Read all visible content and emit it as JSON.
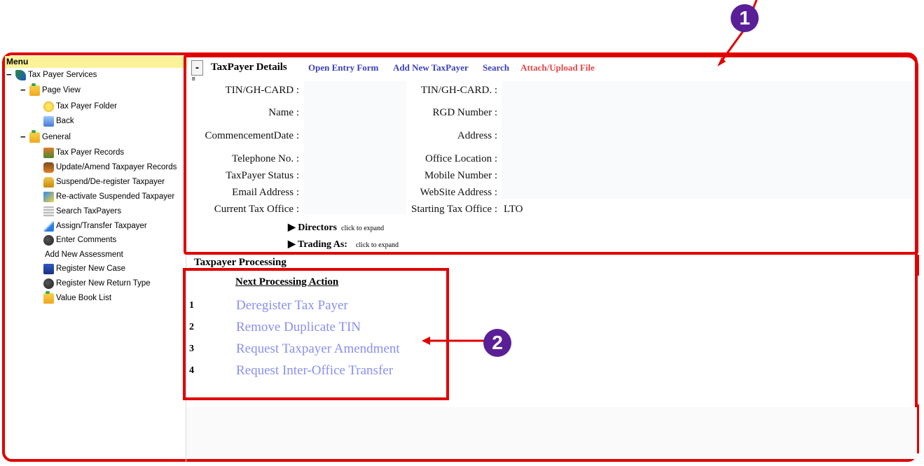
{
  "menu": {
    "header": "Menu",
    "items": [
      {
        "label": "Tax Payer Services",
        "toggle": "−"
      },
      {
        "label": "Page View",
        "toggle": "−"
      },
      {
        "label": "Tax Payer Folder"
      },
      {
        "label": "Back"
      },
      {
        "label": "General",
        "toggle": "−"
      },
      {
        "label": "Tax Payer Records"
      },
      {
        "label": "Update/Amend Taxpayer Records"
      },
      {
        "label": "Suspend/De-register Taxpayer"
      },
      {
        "label": "Re-activate Suspended Taxpayer"
      },
      {
        "label": "Search TaxPayers"
      },
      {
        "label": "Assign/Transfer Taxpayer"
      },
      {
        "label": "Enter Comments"
      },
      {
        "label": "Add New Assessment"
      },
      {
        "label": "Register New Case"
      },
      {
        "label": "Register New Return Type"
      },
      {
        "label": "Value Book List"
      }
    ]
  },
  "details": {
    "collapse_symbol": "-",
    "small_mark": "B",
    "title": "TaxPayer Details",
    "links": {
      "open_entry": "Open Entry Form",
      "add_new": "Add New TaxPayer",
      "search": "Search",
      "attach": "Attach/Upload File"
    },
    "link_color": "#3a3fb8",
    "attach_color": "#e84545",
    "left_fields": [
      {
        "label": "TIN/GH-CARD :"
      },
      {
        "label": "Name :"
      },
      {
        "label": "CommencementDate :"
      },
      {
        "label": "Telephone No. :"
      },
      {
        "label": "TaxPayer Status :"
      },
      {
        "label": "Email Address :"
      },
      {
        "label": "Current Tax Office :"
      }
    ],
    "right_fields": [
      {
        "label": "TIN/GH-CARD. :"
      },
      {
        "label": "RGD Number :"
      },
      {
        "label": "Address :"
      },
      {
        "label": "Office Location :"
      },
      {
        "label": "Mobile Number :"
      },
      {
        "label": "WebSite Address :"
      },
      {
        "label": "Starting Tax Office :",
        "value": "LTO"
      }
    ],
    "expanders": [
      {
        "label": "Directors",
        "hint": "click to expand"
      },
      {
        "label": "Trading As:",
        "hint": "click to expand"
      }
    ]
  },
  "processing": {
    "section_title": "Taxpayer Processing",
    "header": "Next Processing Action",
    "action_color": "#8a8ff0",
    "actions": [
      {
        "num": "1",
        "label": "Deregister Tax Payer"
      },
      {
        "num": "2",
        "label": "Remove Duplicate TIN"
      },
      {
        "num": "3",
        "label": "Request Taxpayer Amendment"
      },
      {
        "num": "4",
        "label": "Request Inter-Office Transfer"
      }
    ]
  },
  "callouts": {
    "first": "1",
    "second": "2",
    "color": "#5a1f96"
  }
}
